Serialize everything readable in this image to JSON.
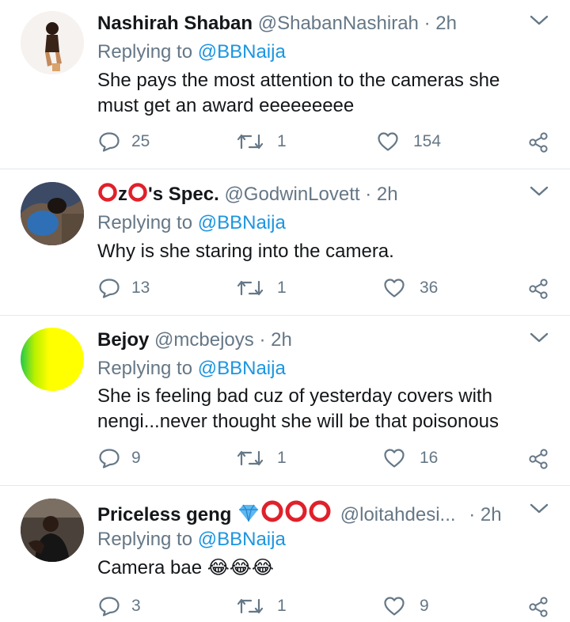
{
  "tweets": [
    {
      "name": "Nashirah Shaban",
      "handle": "@ShabanNashirah",
      "time": "2h",
      "replying_prefix": "Replying to",
      "replying_to": "@BBNaija",
      "text_lines": [
        "She pays the most attention to the cameras she",
        "must get an award eeeeeeeee"
      ],
      "replies": "25",
      "retweets": "1",
      "likes": "154"
    },
    {
      "name_parts": [
        "z",
        "'s Spec."
      ],
      "handle": "@GodwinLovett",
      "time": "2h",
      "replying_prefix": "Replying to",
      "replying_to": "@BBNaija",
      "text_lines": [
        "Why is she staring into the camera."
      ],
      "replies": "13",
      "retweets": "1",
      "likes": "36"
    },
    {
      "name": "Bejoy",
      "handle": "@mcbejoys",
      "time": "2h",
      "replying_prefix": "Replying to",
      "replying_to": "@BBNaija",
      "text_lines": [
        "She is feeling bad cuz of yesterday covers with",
        "nengi...never thought she will be that poisonous"
      ],
      "replies": "9",
      "retweets": "1",
      "likes": "16"
    },
    {
      "name": "Priceless geng",
      "handle": "@loitahdesi...",
      "time": "2h",
      "replying_prefix": "Replying to",
      "replying_to": "@BBNaija",
      "text": "Camera bae",
      "emoji": "😂😂😂",
      "replies": "3",
      "retweets": "1",
      "likes": "9"
    }
  ],
  "icons": {
    "more": "chevron-down-icon",
    "reply": "reply-icon",
    "retweet": "retweet-icon",
    "like": "heart-icon",
    "share": "share-icon",
    "diamond": "diamond-emoji",
    "ring": "red-ring-emoji"
  },
  "colors": {
    "link": "#1b95e0",
    "muted": "#657786",
    "text": "#14171a",
    "ring": "#e0202a",
    "diamond": "#55b4f0"
  }
}
